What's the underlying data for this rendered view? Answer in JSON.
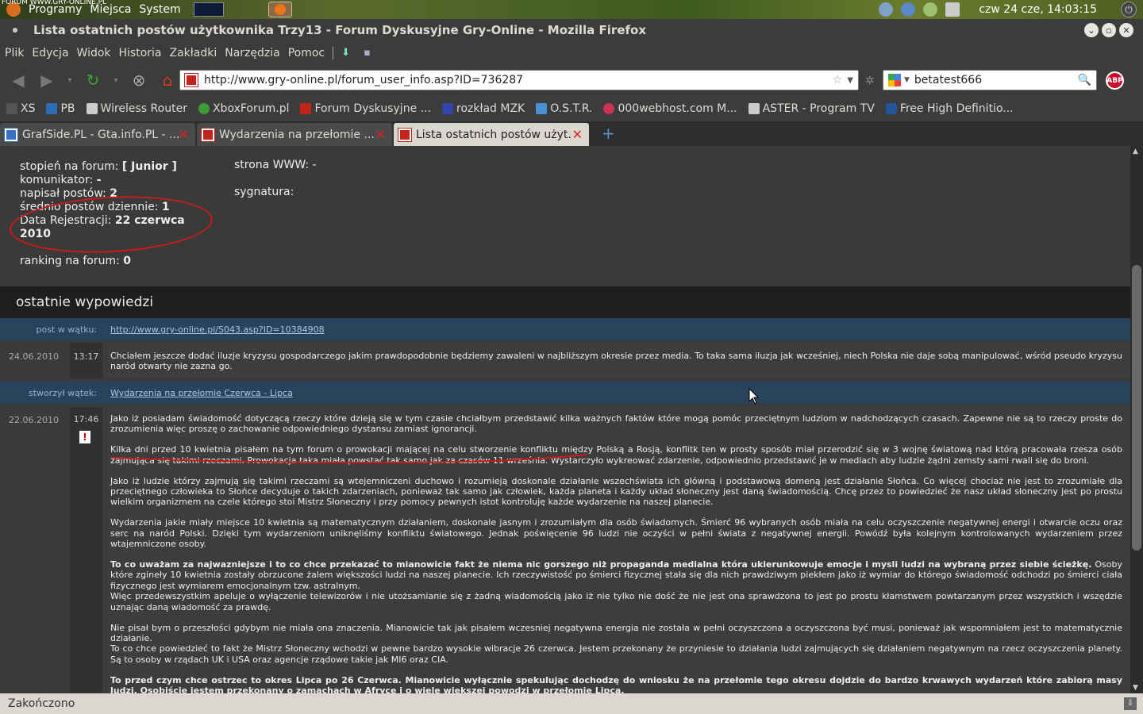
{
  "panel": {
    "watermark": "FORUM WWW.GRY-ONLINE.PL",
    "menu_apps": "Programy",
    "menu_places": "Miejsca",
    "menu_system": "System",
    "clock": "czw 24 cze, 14:03:15"
  },
  "window": {
    "title": "Lista ostatnich postów użytkownika Trzy13 - Forum Dyskusyjne Gry-Online - Mozilla Firefox"
  },
  "menubar": {
    "items": [
      "Plik",
      "Edycja",
      "Widok",
      "Historia",
      "Zakładki",
      "Narzędzia",
      "Pomoc"
    ]
  },
  "navbar": {
    "url": "http://www.gry-online.pl/forum_user_info.asp?ID=736287",
    "search_value": "betatest666",
    "abp_label": "ABP"
  },
  "bookmarks": [
    {
      "label": "XS",
      "color": "#555555"
    },
    {
      "label": "PB",
      "color": "#2a6fb8"
    },
    {
      "label": "Wireless Router",
      "color": "#cccccc"
    },
    {
      "label": "XboxForum.pl",
      "color": "#3d9b35"
    },
    {
      "label": "Forum Dyskusyjne ...",
      "color": "#c2241b"
    },
    {
      "label": "rozkład MZK",
      "color": "#3344aa"
    },
    {
      "label": "O.S.T.R.",
      "color": "#4a90d9"
    },
    {
      "label": "000webhost.com M...",
      "color": "#cc3355"
    },
    {
      "label": "ASTER - Program TV",
      "color": "#cccccc"
    },
    {
      "label": "Free High Definitio...",
      "color": "#225599"
    }
  ],
  "tabs": [
    {
      "label": "GrafSide.PL - Gta.info.PL - ...",
      "active": false
    },
    {
      "label": "Wydarzenia na przełomie ...",
      "active": false
    },
    {
      "label": "Lista ostatnich postów użyt...",
      "active": true
    }
  ],
  "profile": {
    "rank_label": "stopień na forum:",
    "rank_value": "[ Junior ]",
    "im_label": "komunikator:",
    "im_value": "-",
    "posts_label": "napisał postów:",
    "posts_value": "2",
    "daily_label": "średnio postów dziennie:",
    "daily_value": "1",
    "reg_label": "Data Rejestracji:",
    "reg_value_1": "22 czerwca",
    "reg_value_2": "2010",
    "ranking_label": "ranking na forum:",
    "ranking_value": "0",
    "www_label": "strona WWW: -",
    "sig_label": "sygnatura:"
  },
  "section_title": "ostatnie wypowiedzi",
  "posts": [
    {
      "context_label": "post w wątku:",
      "context_link": "http://www.gry-online.pl/S043.asp?ID=10384908",
      "date": "24.06.2010",
      "time": "13:17",
      "body": "Chciałem jeszcze dodać iluzje kryzysu gospodarczego jakim prawdopodobnie będziemy zawaleni w najbliższym okresie przez media. To taka sama iluzja jak wcześniej, niech Polska nie daje sobą manipulować, wśród pseudo kryzysu naród otwarty nie zazna go."
    },
    {
      "context_label": "stworzył wątek:",
      "context_link": "Wydarzenia na przełomie Czerwca - Lipca",
      "date": "22.06.2010",
      "time": "17:46",
      "warn": "!",
      "paragraphs": [
        "Jako iż posiadam świadomość dotyczącą rzeczy które dzieją się w tym czasie chciałbym przedstawić kilka ważnych faktów które mogą pomóc przeciętnym ludziom w nadchodzących czasach. Zapewne nie są to rzeczy proste do zrozumienia więc proszę o zachowanie odpowiedniego dystansu zamiast ignorancji.",
        "Kilka dni przed 10 kwietnia pisałem na tym forum o prowokacji mającej na celu stworzenie konfliktu między Polską a Rosją, konflitk ten w prosty sposób miał przerodzić się w 3 wojnę światową nad którą pracowała rzesza osób zajmująca się takimi rzeczami. Prowokacja taka miała powstać tak samo jak za czasów 11 września. Wystarczyło wykreować zdarzenie, odpowiednio przedstawić je w mediach aby ludzie żądni zemsty sami rwali się do broni.",
        "Jako iż ludzie którzy zajmują się takimi rzeczami są wtejemniczeni duchowo i rozumieją doskonale działanie wszechświata ich główną i podstawową domeną jest działanie Słońca. Co więcej chociaż nie jest to zrozumiałe dla przeciętnego człowieka to Słońce decyduje o takich zdarzeniach, ponieważ tak samo jak człowiek, każda planeta i każdy układ słoneczny jest daną świadomością. Chcę przez to powiedzieć że nasz układ słoneczny jest po prostu wielkim organizmem na czele którego stoi Mistrz Słoneczny i przy pomocy pewnych istot kontroluję każde wydarzenie na naszej planecie.",
        "Wydarzenia jakie miały miejsce 10 kwietnia są matematycznym działaniem, doskonale jasnym i zrozumiałym dla osób świadomych. Śmierć 96 wybranych osób miała na celu oczyszczenie negatywnej energi i otwarcie oczu oraz serc na naród Polski. Dzięki tym wydarzeniom uniknęliśmy konfliktu światowego. Jednak poświęcenie 96 ludzi nie oczyści w pełni świata z negatywnej energii. Powódź była kolejnym kontrolowanych wydarzeniem przez wtajemniczone osoby."
      ],
      "p5_bold": "To co uważam za najwazniejsze i to co chce przekazać to mianowicie fakt że niema nic gorszego niż propaganda medialna która ukierunkowuje emocje i mysli ludzi na wybraną przez siebie ścieżkę.",
      "p5_rest": " Osoby które zgineły 10 kwietnia zostały obrzucone żalem większości ludzi na naszej planecie. Ich rzeczywistość po śmierci fizycznej stała się dla nich prawdziwym piekłem jako iż wymiar do którego świadomość odchodzi po śmierci ciała fizycznego jest wymiarem emocjonalnym tzw. astralnym.",
      "p5_line2": "Więc przedewszystkim apeluje o wyłączenie telewizorów i nie utożsamianie się z żadną wiadomością jako iż nie tylko nie dość że nie jest ona sprawdzona to jest po prostu kłamstwem powtarzanym przez wszystkich i wszędzie uznając daną wiadomość za prawdę.",
      "p6_line1": "Nie pisał bym o przeszłości gdybym nie miała ona znaczenia. Mianowicie tak jak pisałem wczesniej negatywna energia nie została w pełni oczyszczona a oczyszczona być musi, ponieważ jak wspomniałem jest to matematycznie działanie.",
      "p6_line2": "To co chce powiedzieć to fakt że Mistrz Słoneczny wchodzi w pewne bardzo wysokie wibracje 26 czerwca. Jestem przekonany że przyniesie to działania ludzi zajmujących się działaniem negatywnym na rzecz oczyszczenia planety. Są to osoby w rządach UK i USA oraz agencje rządowe takie jak MI6 oraz CIA.",
      "p7_bold": "To przed czym chce ostrzec to okres Lipca po 26 Czerwca. Mianowicie wyłącznie spekulując dochodzę do wniosku że na przełomie tego okresu dojdzie do bardzo krwawych wydarzeń które zabiorą masy ludzi. Osobiście jestem przekonany o zamachach w Afryce i o wiele większej powodzi w przełomie Lipca."
    }
  ],
  "statusbar": {
    "text": "Zakończono"
  }
}
